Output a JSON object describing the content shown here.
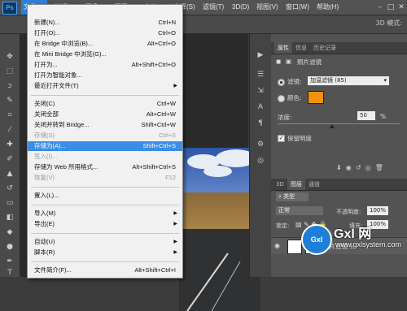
{
  "app": {
    "logo": "Ps"
  },
  "menubar": {
    "items": [
      "文件(F)",
      "编辑(E)",
      "图像(I)",
      "图层(L)",
      "文字(Y)",
      "选择(S)",
      "滤镜(T)",
      "3D(D)",
      "视图(V)",
      "窗口(W)",
      "帮助(H)"
    ],
    "active_index": 0
  },
  "options_bar": {
    "mode_label": "3D 模式:"
  },
  "file_menu": {
    "items": [
      {
        "label": "新建(N)...",
        "shortcut": "Ctrl+N",
        "enabled": true
      },
      {
        "label": "打开(O)...",
        "shortcut": "Ctrl+O",
        "enabled": true
      },
      {
        "label": "在 Bridge 中浏览(B)...",
        "shortcut": "Alt+Ctrl+O",
        "enabled": true
      },
      {
        "label": "在 Mini Bridge 中浏览(G)...",
        "shortcut": "",
        "enabled": true
      },
      {
        "label": "打开为...",
        "shortcut": "Alt+Shift+Ctrl+O",
        "enabled": true
      },
      {
        "label": "打开为智能对象...",
        "shortcut": "",
        "enabled": true
      },
      {
        "label": "最近打开文件(T)",
        "shortcut": "",
        "enabled": true,
        "submenu": true
      },
      {
        "label": "关闭(C)",
        "shortcut": "Ctrl+W",
        "enabled": true
      },
      {
        "label": "关闭全部",
        "shortcut": "Alt+Ctrl+W",
        "enabled": true
      },
      {
        "label": "关闭并转到 Bridge...",
        "shortcut": "Shift+Ctrl+W",
        "enabled": true
      },
      {
        "label": "存储(S)",
        "shortcut": "Ctrl+S",
        "enabled": false
      },
      {
        "label": "存储为(A)...",
        "shortcut": "Shift+Ctrl+S",
        "enabled": true,
        "highlighted": true
      },
      {
        "label": "签入(I)...",
        "shortcut": "",
        "enabled": false
      },
      {
        "label": "存储为 Web 所用格式...",
        "shortcut": "Alt+Shift+Ctrl+S",
        "enabled": true
      },
      {
        "label": "恢复(V)",
        "shortcut": "F12",
        "enabled": false
      },
      {
        "label": "置入(L)...",
        "shortcut": "",
        "enabled": true
      },
      {
        "label": "导入(M)",
        "shortcut": "",
        "enabled": true,
        "submenu": true
      },
      {
        "label": "导出(E)",
        "shortcut": "",
        "enabled": true,
        "submenu": true
      },
      {
        "label": "自动(U)",
        "shortcut": "",
        "enabled": true,
        "submenu": true
      },
      {
        "label": "脚本(R)",
        "shortcut": "",
        "enabled": true,
        "submenu": true
      },
      {
        "label": "文件简介(F)...",
        "shortcut": "Alt+Shift+Ctrl+I",
        "enabled": true
      }
    ]
  },
  "properties_panel": {
    "tabs": [
      "属性",
      "信息",
      "历史记录"
    ],
    "header": "照片滤镜",
    "filter_radio_label": "滤镜:",
    "filter_value": "加温滤镜 (85)",
    "color_radio_label": "颜色:",
    "color_swatch": "#f0920f",
    "density_label": "浓度:",
    "density_value": "50",
    "density_unit": "%",
    "preserve_label": "保留明度"
  },
  "layers_panel": {
    "tabs": [
      "3D",
      "图层",
      "通道"
    ],
    "filter_kind": "类型",
    "blend_mode": "正常",
    "opacity_label": "不透明度:",
    "opacity_value": "100%",
    "lock_label": "锁定:",
    "fill_label": "填充:",
    "fill_value": "100%",
    "layer_name": "照片滤镜 1"
  },
  "watermark": {
    "logo": "Gxl",
    "text": "Gxl 网",
    "url": "www.gxlsystem.com"
  }
}
